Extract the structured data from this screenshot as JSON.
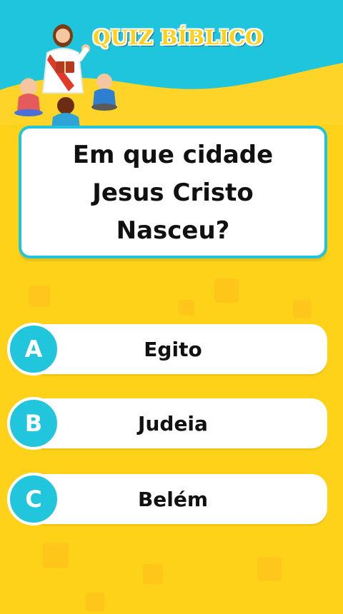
{
  "header": {
    "title": "QUIZ BÍBLICO"
  },
  "question": {
    "text": "Em que cidade Jesus Cristo Nasceu?"
  },
  "answers": [
    {
      "letter": "A",
      "text": "Egito"
    },
    {
      "letter": "B",
      "text": "Judeia"
    },
    {
      "letter": "C",
      "text": "Belém"
    }
  ],
  "colors": {
    "background": "#ffd21a",
    "header": "#1fc5dc",
    "accent": "#22c6dc",
    "card": "#ffffff"
  }
}
